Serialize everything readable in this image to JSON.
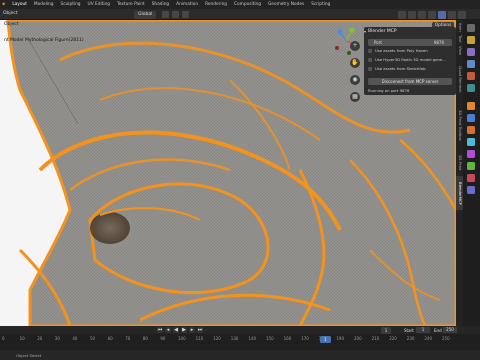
{
  "menu": {
    "tabs": [
      "Layout",
      "Modeling",
      "Sculpting",
      "UV Editing",
      "Texture Paint",
      "Shading",
      "Animation",
      "Rendering",
      "Compositing",
      "Geometry Nodes",
      "Scripting"
    ],
    "active_tab": "Layout"
  },
  "header": {
    "mode": "Object",
    "orientation": "Global"
  },
  "viewport": {
    "object_label": "Object",
    "object_name": "nt Model Mythological Figure(2811)",
    "mesh_color": "#f4921e",
    "shade_color": "#8c8a86",
    "background": "#f5f5f5"
  },
  "gizmo": {
    "x_label": "X",
    "y_label": "Y",
    "z_label": "Z"
  },
  "mcp": {
    "title": "Blender MCP",
    "port_label": "Port",
    "port_value": "9876",
    "opt_poly_haven": "Use assets from Poly Haven",
    "opt_hyper3d": "Use Hyper3D Rodin 3D model gene...",
    "opt_sketchfab": "Use assets from Sketchfab",
    "disconnect_label": "Disconnect from MCP server",
    "status": "Running on port 9876"
  },
  "options_label": "Options",
  "sidebar_tabs": [
    "Item",
    "Tool",
    "View",
    "Quad Remesh",
    "3D Print Toolbox",
    "3D-Print",
    "BlenderMCP"
  ],
  "timeline": {
    "current_frame": "1",
    "start_label": "Start",
    "start": "1",
    "end_label": "End",
    "end": "250",
    "ticks": [
      "0",
      "10",
      "20",
      "30",
      "40",
      "50",
      "60",
      "70",
      "80",
      "90",
      "100",
      "110",
      "120",
      "130",
      "140",
      "150",
      "160",
      "170",
      "180",
      "190",
      "200",
      "210",
      "220",
      "230",
      "240",
      "250"
    ],
    "playhead": "1"
  },
  "status": {
    "text": "Object Select"
  }
}
